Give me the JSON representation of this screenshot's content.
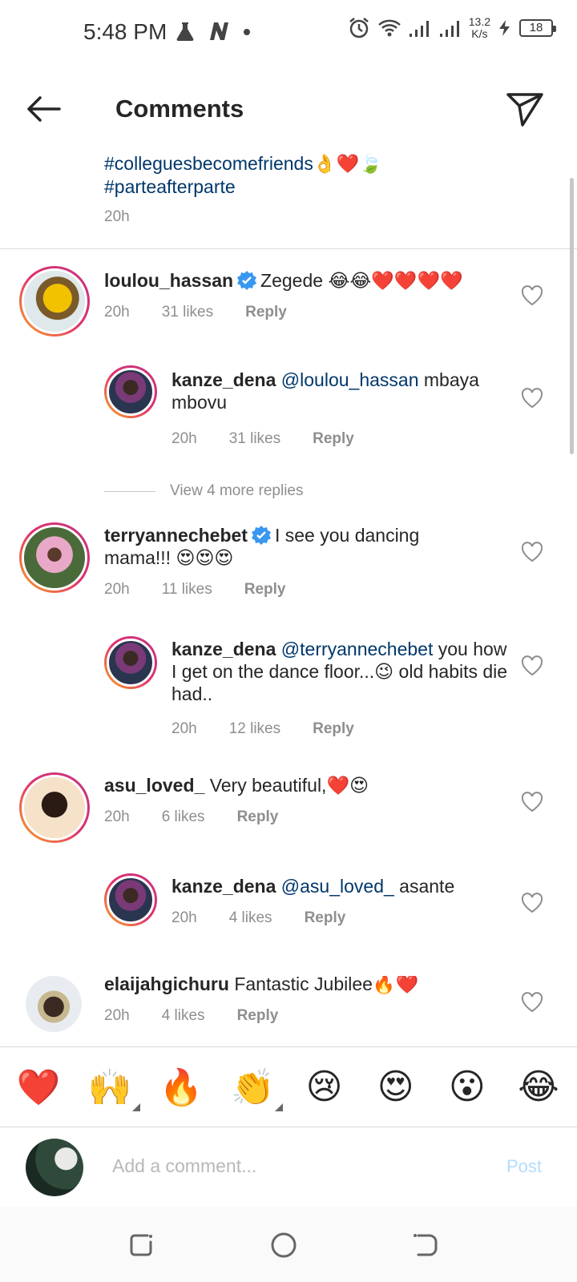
{
  "status_bar": {
    "time": "5:48 PM",
    "net_speed_value": "13.2",
    "net_speed_unit": "K/s",
    "battery": "18"
  },
  "header": {
    "title": "Comments"
  },
  "caption": {
    "line1": "#colleguesbecomefriends👌❤️🍃",
    "line2": "#parteafterparte",
    "time": "20h"
  },
  "comments": [
    {
      "username": "loulou_hassan",
      "verified": true,
      "text": "Zegede 😂😂❤️❤️❤️❤️",
      "time": "20h",
      "likes": "31 likes",
      "reply_label": "Reply"
    },
    {
      "username": "kanze_dena",
      "mention": "@loulou_hassan",
      "text": " mbaya mbovu",
      "time": "20h",
      "likes": "31 likes",
      "reply_label": "Reply"
    },
    {
      "username": "terryannechebet",
      "verified": true,
      "text": "I see you dancing mama!!! 😍😍😍",
      "time": "20h",
      "likes": "11 likes",
      "reply_label": "Reply"
    },
    {
      "username": "kanze_dena",
      "mention": "@terryannechebet",
      "text": " you how I get on the dance floor...😉 old habits die had..",
      "time": "20h",
      "likes": "12 likes",
      "reply_label": "Reply"
    },
    {
      "username": "asu_loved_",
      "text": "Very beautiful,❤️😍",
      "time": "20h",
      "likes": "6 likes",
      "reply_label": "Reply"
    },
    {
      "username": "kanze_dena",
      "mention": "@asu_loved_",
      "text": " asante",
      "time": "20h",
      "likes": "4 likes",
      "reply_label": "Reply"
    },
    {
      "username": "elaijahgichuru",
      "text": "Fantastic Jubilee🔥❤️",
      "time": "20h",
      "likes": "4 likes",
      "reply_label": "Reply"
    }
  ],
  "view_more": "View 4 more replies",
  "emoji_bar": [
    "❤️",
    "🙌",
    "🔥",
    "👏",
    "😢",
    "😍",
    "😮",
    "😂"
  ],
  "composer": {
    "placeholder": "Add a comment...",
    "post_label": "Post"
  },
  "colors": {
    "hashtag_blue": "#00376b",
    "verified_blue": "#3897f0",
    "meta_gray": "#8e8e8e",
    "post_disabled": "#b3dbff"
  }
}
